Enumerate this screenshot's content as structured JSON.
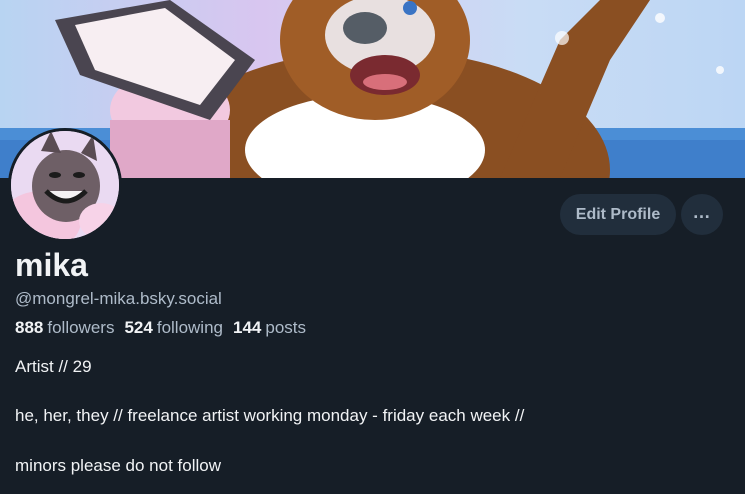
{
  "profile": {
    "display_name": "mika",
    "handle": "@mongrel-mika.bsky.social",
    "followers_count": "888",
    "followers_label": "followers",
    "following_count": "524",
    "following_label": "following",
    "posts_count": "144",
    "posts_label": "posts",
    "bio_lines": [
      "Artist // 29",
      "he, her, they // freelance artist working monday - friday each week //",
      "minors please do not follow"
    ]
  },
  "actions": {
    "edit_profile_label": "Edit Profile",
    "more_icon": "ellipsis-icon"
  },
  "colors": {
    "background": "#161e27",
    "button_bg": "#212e3c",
    "muted_text": "#aebbc9",
    "text": "#f1f3f5"
  }
}
